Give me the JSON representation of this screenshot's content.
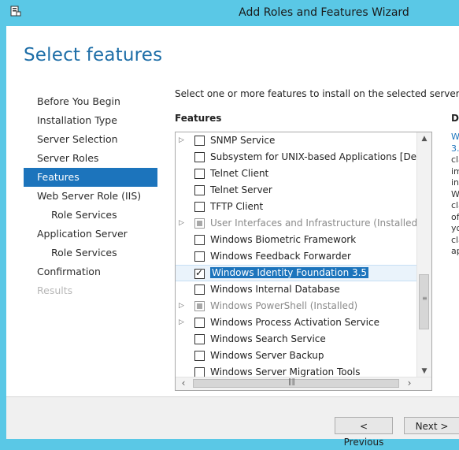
{
  "window": {
    "title": "Add Roles and Features Wizard"
  },
  "page": {
    "title": "Select features",
    "intro": "Select one or more features to install on the selected server.",
    "features_heading": "Features",
    "description_heading": "D",
    "description_lines": [
      "W",
      "3.",
      "cla",
      "im",
      "in",
      "W",
      "cla",
      "of",
      "yo",
      "cla",
      "ap"
    ]
  },
  "nav": {
    "items": [
      {
        "label": "Before You Begin",
        "state": "normal"
      },
      {
        "label": "Installation Type",
        "state": "normal"
      },
      {
        "label": "Server Selection",
        "state": "normal"
      },
      {
        "label": "Server Roles",
        "state": "normal"
      },
      {
        "label": "Features",
        "state": "active"
      },
      {
        "label": "Web Server Role (IIS)",
        "state": "normal"
      },
      {
        "label": "Role Services",
        "state": "sub"
      },
      {
        "label": "Application Server",
        "state": "normal"
      },
      {
        "label": "Role Services",
        "state": "sub"
      },
      {
        "label": "Confirmation",
        "state": "normal"
      },
      {
        "label": "Results",
        "state": "disabled"
      }
    ]
  },
  "features": [
    {
      "label": "SNMP Service",
      "expandable": true,
      "check": "unchecked"
    },
    {
      "label": "Subsystem for UNIX-based Applications [Deprecated]",
      "expandable": false,
      "check": "unchecked"
    },
    {
      "label": "Telnet Client",
      "expandable": false,
      "check": "unchecked"
    },
    {
      "label": "Telnet Server",
      "expandable": false,
      "check": "unchecked"
    },
    {
      "label": "TFTP Client",
      "expandable": false,
      "check": "unchecked"
    },
    {
      "label": "User Interfaces and Infrastructure (Installed)",
      "expandable": true,
      "check": "partial",
      "installed": true
    },
    {
      "label": "Windows Biometric Framework",
      "expandable": false,
      "check": "unchecked"
    },
    {
      "label": "Windows Feedback Forwarder",
      "expandable": false,
      "check": "unchecked"
    },
    {
      "label": "Windows Identity Foundation 3.5",
      "expandable": false,
      "check": "checked",
      "selected": true
    },
    {
      "label": "Windows Internal Database",
      "expandable": false,
      "check": "unchecked"
    },
    {
      "label": "Windows PowerShell (Installed)",
      "expandable": true,
      "check": "partial",
      "installed": true
    },
    {
      "label": "Windows Process Activation Service",
      "expandable": true,
      "check": "unchecked"
    },
    {
      "label": "Windows Search Service",
      "expandable": false,
      "check": "unchecked"
    },
    {
      "label": "Windows Server Backup",
      "expandable": false,
      "check": "unchecked"
    },
    {
      "label": "Windows Server Migration Tools",
      "expandable": false,
      "check": "unchecked"
    }
  ],
  "buttons": {
    "previous": "< Previous",
    "next": "Next >"
  },
  "icons": {
    "app": "server-manager-icon",
    "expand": "expand-arrow-icon"
  },
  "colors": {
    "titlebar": "#5ac8e6",
    "accent": "#1c74bc",
    "title_text": "#1f6fa8"
  }
}
